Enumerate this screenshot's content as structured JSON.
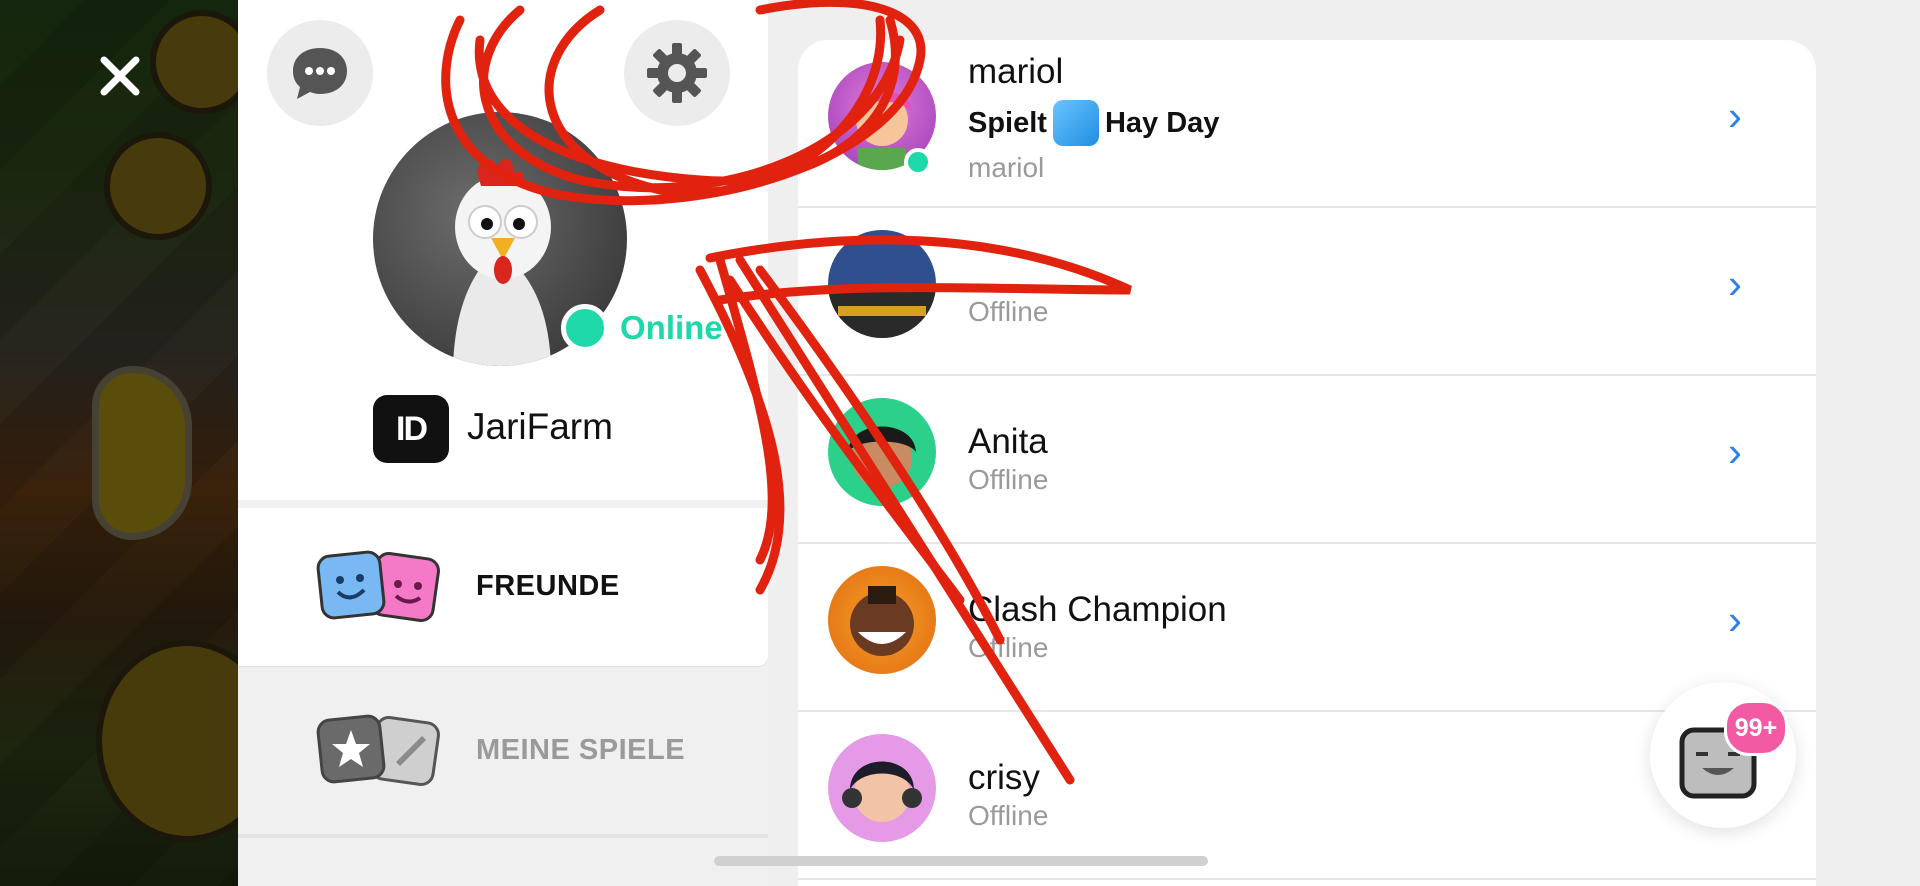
{
  "header": {
    "close_icon": "close-icon",
    "chat_icon": "chat-bubble-icon",
    "settings_icon": "gear-icon"
  },
  "profile": {
    "status": "Online",
    "id_badge": "ID",
    "username": "JariFarm",
    "status_color": "#1ed8a9"
  },
  "tabs": [
    {
      "label": "FREUNDE",
      "active": true
    },
    {
      "label": "MEINE SPIELE",
      "active": false
    }
  ],
  "friends": [
    {
      "name": "mariol",
      "playing_prefix": "Spielt",
      "game": "Hay Day",
      "subtitle": "mariol",
      "online": true
    },
    {
      "name": "",
      "status": "Offline",
      "online": false
    },
    {
      "name": "Anita",
      "status": "Offline",
      "online": false
    },
    {
      "name": "Clash Champion",
      "status": "Offline",
      "online": false
    },
    {
      "name": "crisy",
      "status": "Offline",
      "online": false
    }
  ],
  "notification": {
    "count": "99+",
    "icon": "face-icon",
    "badge_color": "#f25aa3"
  },
  "accent_color": "#2b7ff0"
}
